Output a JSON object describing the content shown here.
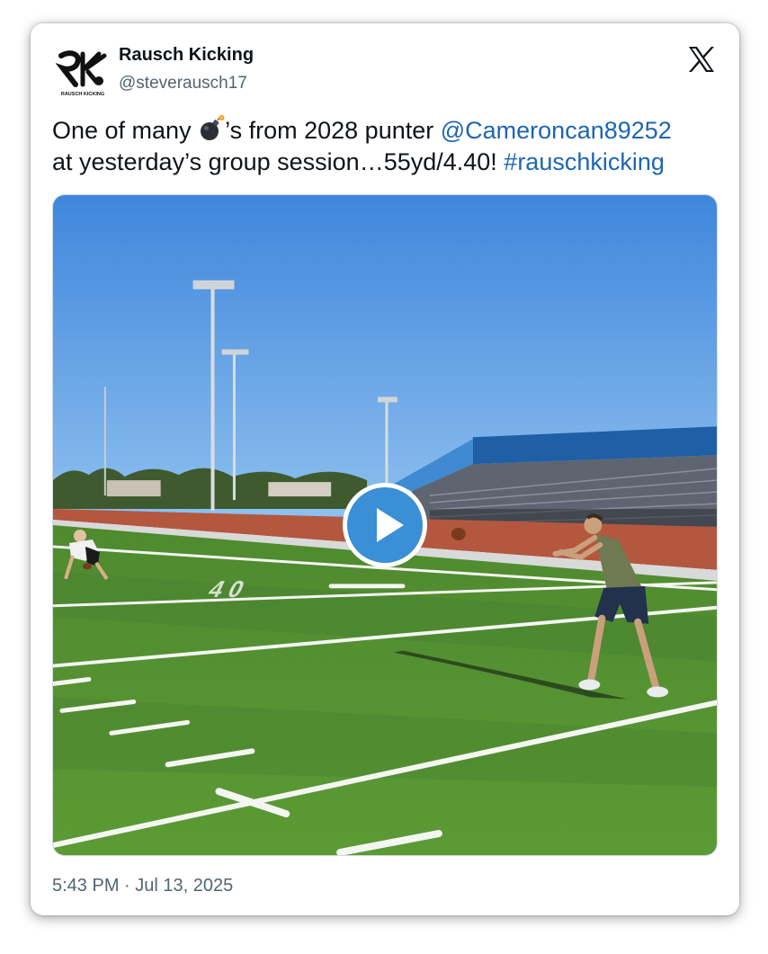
{
  "author": {
    "name": "Rausch Kicking",
    "handle": "@steverausch17",
    "avatar_brand": "RAUSCH KICKING"
  },
  "platform_icon": "x-logo-icon",
  "tweet": {
    "text_part1": "One of many ",
    "emoji": "bomb-emoji",
    "text_part2": "’s from 2028 punter ",
    "mention": "@Cameroncan89252",
    "text_part3": "at yesterday’s group  session…55yd/4.40! ",
    "hashtag": "#rauschkicking"
  },
  "media": {
    "type": "video",
    "play_icon": "play-icon",
    "accent_color": "#3a8fd6"
  },
  "timestamp": "5:43 PM · Jul 13, 2025",
  "colors": {
    "link": "#1d66b3",
    "secondary_text": "#536471",
    "sky": "#5a9ee6",
    "turf": "#5c8f2e"
  }
}
